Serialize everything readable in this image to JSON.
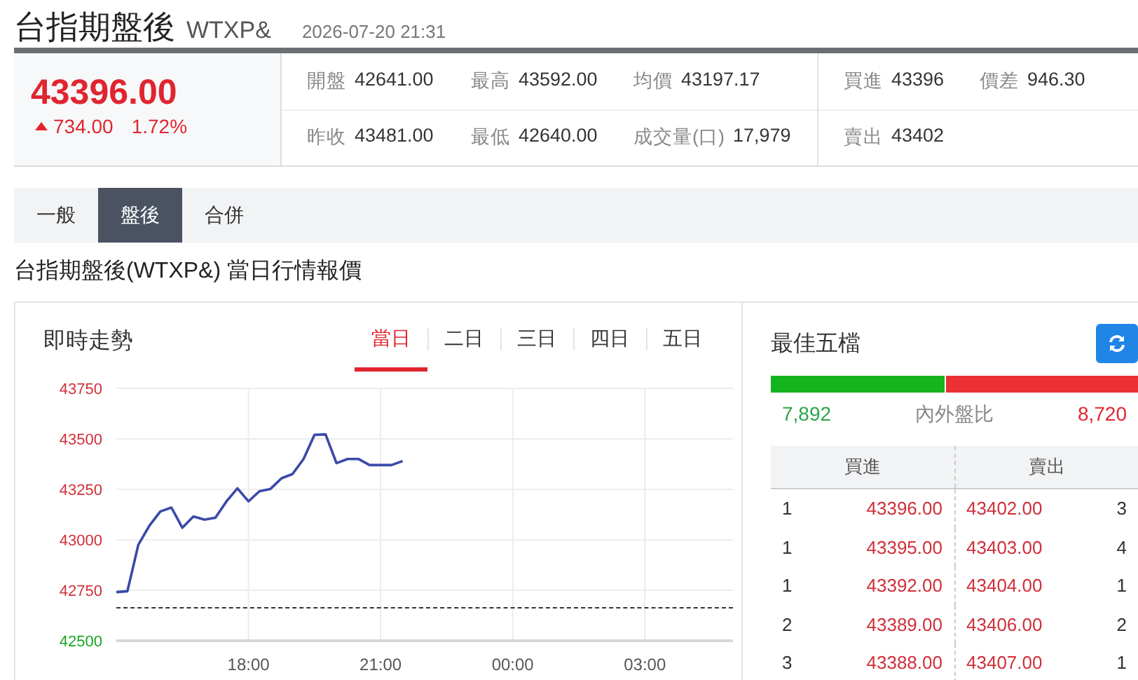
{
  "header": {
    "title": "台指期盤後",
    "symbol": "WTXP&",
    "datetime": "2026-07-20 21:31"
  },
  "quote": {
    "price": "43396.00",
    "rising": true,
    "change": "734.00",
    "change_pct": "1.72%"
  },
  "stats": [
    [
      {
        "label": "開盤",
        "value": "42641.00"
      },
      {
        "label": "最高",
        "value": "43592.00"
      },
      {
        "label": "均價",
        "value": "43197.17"
      }
    ],
    [
      {
        "label": "昨收",
        "value": "43481.00"
      },
      {
        "label": "最低",
        "value": "42640.00"
      },
      {
        "label": "成交量(口)",
        "value": "17,979"
      }
    ]
  ],
  "bidask": [
    [
      {
        "label": "買進",
        "value": "43396"
      },
      {
        "label": "價差",
        "value": "946.30"
      }
    ],
    [
      {
        "label": "賣出",
        "value": "43402"
      }
    ]
  ],
  "tabs": [
    {
      "label": "一般",
      "selected": false
    },
    {
      "label": "盤後",
      "selected": true
    },
    {
      "label": "合併",
      "selected": false
    }
  ],
  "section_title": "台指期盤後(WTXP&) 當日行情報價",
  "trend": {
    "title": "即時走勢",
    "periods": [
      {
        "label": "當日",
        "selected": true
      },
      {
        "label": "二日",
        "selected": false
      },
      {
        "label": "三日",
        "selected": false
      },
      {
        "label": "四日",
        "selected": false
      },
      {
        "label": "五日",
        "selected": false
      }
    ],
    "chart_data": {
      "type": "line",
      "ylim": [
        42500,
        43750
      ],
      "categories": [
        null,
        null,
        null,
        null,
        null,
        null,
        null,
        null,
        null,
        null,
        null,
        null,
        "18:00",
        null,
        null,
        null,
        null,
        null,
        null,
        null,
        null,
        null,
        null,
        null,
        "21:00",
        null,
        null,
        null,
        null,
        null,
        null,
        null,
        null,
        null,
        null,
        null,
        "00:00",
        null,
        null,
        null,
        null,
        null,
        null,
        null,
        null,
        null,
        null,
        null,
        "03:00",
        null,
        null,
        null,
        null,
        null,
        null,
        null,
        null
      ],
      "yticks": [
        43750,
        43500,
        43250,
        43000,
        42750,
        42500
      ],
      "series": [
        {
          "color": "#3a4aa8",
          "values": [
            42741,
            42745,
            42975,
            43070,
            43140,
            43160,
            43060,
            43115,
            43100,
            43110,
            43190,
            43255,
            43190,
            43240,
            43252,
            43305,
            43326,
            43400,
            43520,
            43522,
            43380,
            43400,
            43400,
            43370,
            43370,
            43370,
            43390,
            null,
            null,
            null,
            null,
            null,
            null,
            null,
            null,
            null,
            null,
            null,
            null,
            null,
            null,
            null,
            null,
            null,
            null,
            null,
            null,
            null,
            null,
            null,
            null,
            null,
            null,
            null,
            null,
            null,
            null
          ]
        }
      ],
      "grid": true
    }
  },
  "best5": {
    "title": "最佳五檔",
    "ratio": {
      "inner": "7,892",
      "label": "內外盤比",
      "outer": "8,720",
      "level": 0.475
    },
    "columns": [
      "買進",
      "賣出"
    ],
    "rows": [
      {
        "bid_qty": "1",
        "bid": "43396.00",
        "ask": "43402.00",
        "ask_qty": "3"
      },
      {
        "bid_qty": "1",
        "bid": "43395.00",
        "ask": "43403.00",
        "ask_qty": "4"
      },
      {
        "bid_qty": "1",
        "bid": "43392.00",
        "ask": "43404.00",
        "ask_qty": "1"
      },
      {
        "bid_qty": "2",
        "bid": "43389.00",
        "ask": "43406.00",
        "ask_qty": "2"
      },
      {
        "bid_qty": "3",
        "bid": "43388.00",
        "ask": "43407.00",
        "ask_qty": "1"
      }
    ]
  }
}
